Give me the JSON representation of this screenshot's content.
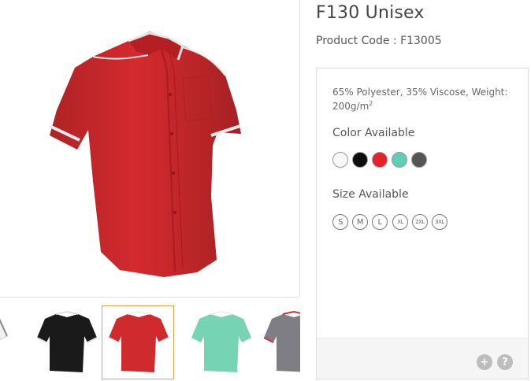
{
  "product": {
    "title": "F130 Unisex",
    "code_line": "Product Code : F13005",
    "material_text": "65% Polyester, 35% Viscose, Weight: 200g/m",
    "material_superscript": "2"
  },
  "colors": {
    "title": "Color Available",
    "swatches": [
      {
        "name": "white",
        "hex": "#f7f7f7"
      },
      {
        "name": "black",
        "hex": "#0d0d0d"
      },
      {
        "name": "red",
        "hex": "#e5222a"
      },
      {
        "name": "mint",
        "hex": "#5ecfb3"
      },
      {
        "name": "grey",
        "hex": "#555555"
      }
    ]
  },
  "sizes": {
    "title": "Size Available",
    "items": [
      "S",
      "M",
      "L",
      "XL",
      "2XL",
      "3XL"
    ]
  },
  "main_image": {
    "icon": "red-shirt-image",
    "shirt_color": "#d42a2e",
    "piping_color": "#e8e8e8"
  },
  "thumbnails": [
    {
      "name": "white-shirt",
      "shirt_color": "#f2f2f2",
      "active": false
    },
    {
      "name": "black-shirt",
      "shirt_color": "#1a1a1a",
      "active": false
    },
    {
      "name": "red-shirt",
      "shirt_color": "#cf2a2d",
      "active": true
    },
    {
      "name": "mint-shirt",
      "shirt_color": "#76d3b4",
      "active": false
    },
    {
      "name": "grey-shirt",
      "shirt_color": "#7e7e84",
      "active": false
    }
  ],
  "footer_buttons": {
    "plus": "+",
    "help": "?"
  }
}
